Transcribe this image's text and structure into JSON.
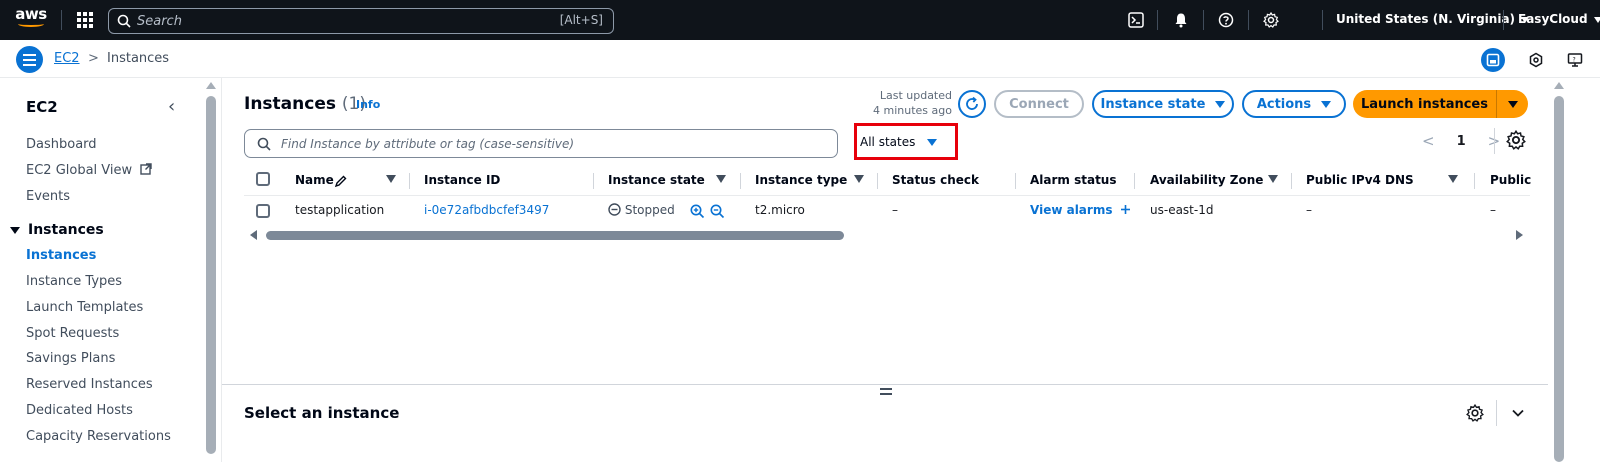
{
  "topnav": {
    "logo": "aws",
    "search_placeholder": "Search",
    "search_shortcut": "[Alt+S]",
    "region": "United States (N. Virginia)",
    "account": "EasyCloud",
    "icons": [
      "cloudshell-icon",
      "bell-icon",
      "help-icon",
      "gear-icon"
    ]
  },
  "breadcrumb": {
    "root": "EC2",
    "separator": ">",
    "current": "Instances"
  },
  "sidebar": {
    "title": "EC2",
    "top_items": [
      {
        "label": "Dashboard"
      },
      {
        "label": "EC2 Global View"
      },
      {
        "label": "Events"
      }
    ],
    "section": "Instances",
    "section_items": [
      {
        "label": "Instances",
        "active": true
      },
      {
        "label": "Instance Types"
      },
      {
        "label": "Launch Templates"
      },
      {
        "label": "Spot Requests"
      },
      {
        "label": "Savings Plans"
      },
      {
        "label": "Reserved Instances"
      },
      {
        "label": "Dedicated Hosts"
      },
      {
        "label": "Capacity Reservations"
      }
    ]
  },
  "main": {
    "title": "Instances",
    "count": "(1)",
    "info": "Info",
    "last_updated_line1": "Last updated",
    "last_updated_line2": "4 minutes ago",
    "buttons": {
      "connect": "Connect",
      "instance_state": "Instance state",
      "actions": "Actions",
      "launch": "Launch instances"
    },
    "filter_placeholder": "Find Instance by attribute or tag (case-sensitive)",
    "state_filter": "All states",
    "pager": {
      "prev": "<",
      "page": "1",
      "next": ">"
    },
    "columns": [
      "Name",
      "Instance ID",
      "Instance state",
      "Instance type",
      "Status check",
      "Alarm status",
      "Availability Zone",
      "Public IPv4 DNS",
      "Public"
    ],
    "row": {
      "name": "testapplication",
      "instance_id": "i-0e72afbdbcfef3497",
      "state": "Stopped",
      "type": "t2.micro",
      "status_check": "–",
      "alarm": "View alarms",
      "az": "us-east-1d",
      "dns": "–",
      "public": "–"
    },
    "detail_title": "Select an instance"
  },
  "colors": {
    "nav_bg": "#0f141a",
    "accent_blue": "#0972d3",
    "primary_orange": "#ff9900",
    "highlight_red": "#e7000b"
  }
}
